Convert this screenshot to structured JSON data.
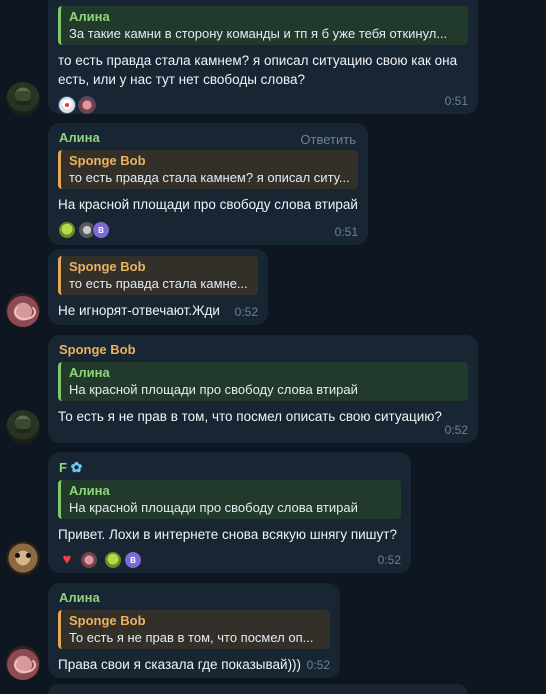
{
  "messages": [
    {
      "reply": {
        "name": "Алина",
        "text": "За такие камни в сторону команды и тп я б уже тебя откинул..."
      },
      "text_lines": [
        "то есть правда стала камнем? я описал ситуацию свою как она",
        "есть, или у нас тут нет свободы слова?"
      ],
      "time": "0:51",
      "reactions": [
        "clown",
        "brain"
      ]
    },
    {
      "sender": "Алина",
      "reply_action": "Ответить",
      "reply": {
        "name": "Sponge Bob",
        "text": "то есть правда стала камнем? я описал ситу..."
      },
      "text": "На красной площади про свободу слова втирай",
      "time": "0:51",
      "reactions": [
        "sick-face",
        "wolf",
        "B"
      ]
    },
    {
      "reply": {
        "name": "Sponge Bob",
        "text": "то есть правда стала камне..."
      },
      "text": "Не игнорят-отвечают.Жди",
      "time": "0:52"
    },
    {
      "sender": "Sponge Bob",
      "reply": {
        "name": "Алина",
        "text": "На красной площади про свободу слова втирай"
      },
      "text": "То есть я не прав в том, что посмел описать свою ситуацию?",
      "time": "0:52"
    },
    {
      "sender": "F",
      "sender_emoji": "✿",
      "reply": {
        "name": "Алина",
        "text": "На красной площади про свободу слова втирай"
      },
      "text": "Привет. Лохи в интернете снова всякую шнягу пишут?",
      "time": "0:52",
      "reactions": [
        "heart",
        "brain",
        "sick-face",
        "B"
      ]
    },
    {
      "sender": "Алина",
      "reply": {
        "name": "Sponge Bob",
        "text": "То есть я не прав в том, что посмел оп..."
      },
      "text": "Права свои я сказала где показывай)))",
      "time": "0:52"
    }
  ],
  "reaction_letter": "B",
  "colors": {
    "background": "#0e1621",
    "bubble": "#182533",
    "alina": "#8fd67b",
    "sponge": "#ecb25f"
  }
}
